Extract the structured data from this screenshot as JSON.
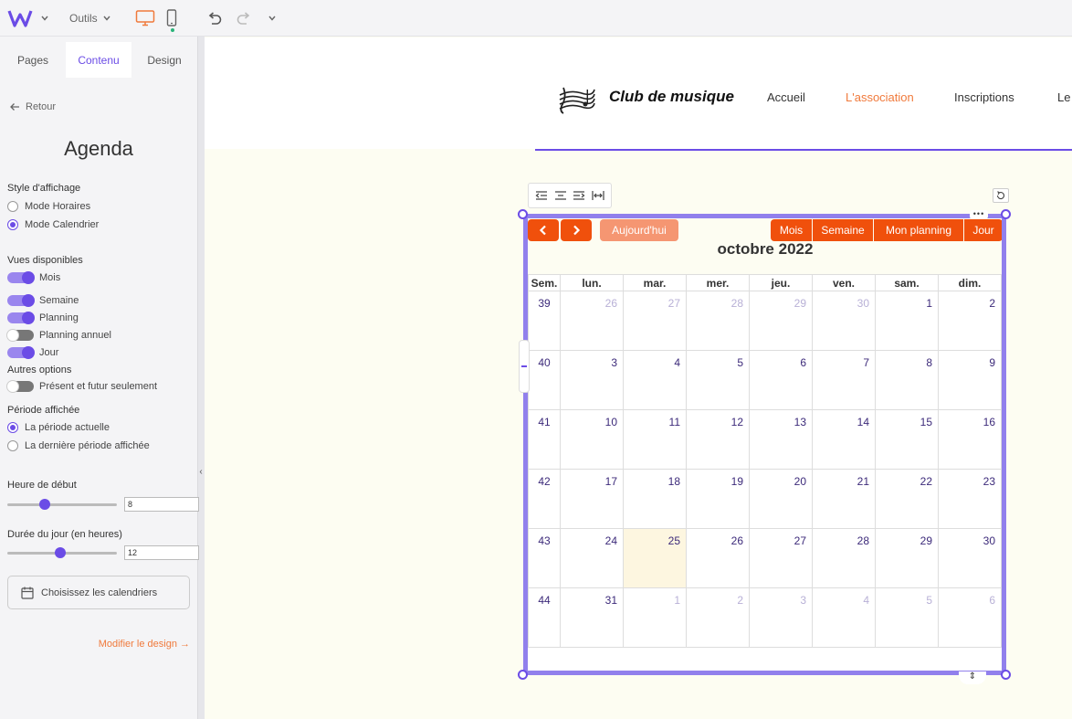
{
  "toolbar": {
    "tools_label": "Outils",
    "logo_icon": "wix-w-logo",
    "accent": "#6b4ce6"
  },
  "panel": {
    "tabs": [
      {
        "label": "Pages"
      },
      {
        "label": "Contenu"
      },
      {
        "label": "Design"
      }
    ],
    "back_label": "Retour",
    "title": "Agenda",
    "display_style": {
      "label": "Style d'affichage",
      "options": [
        {
          "label": "Mode Horaires",
          "selected": false
        },
        {
          "label": "Mode Calendrier",
          "selected": true
        }
      ]
    },
    "available_views": {
      "label": "Vues disponibles",
      "items": [
        {
          "label": "Mois",
          "on": true
        },
        {
          "label": "Semaine",
          "on": true
        },
        {
          "label": "Planning",
          "on": true
        },
        {
          "label": "Planning annuel",
          "on": false
        },
        {
          "label": "Jour",
          "on": true
        }
      ]
    },
    "other_options": {
      "label": "Autres options",
      "items": [
        {
          "label": "Présent et futur seulement",
          "on": false
        }
      ]
    },
    "period": {
      "label": "Période affichée",
      "options": [
        {
          "label": "La période actuelle",
          "selected": true
        },
        {
          "label": "La dernière période affichée",
          "selected": false
        }
      ]
    },
    "start_hour": {
      "label": "Heure de début",
      "value": "8",
      "fraction": 0.34
    },
    "day_duration": {
      "label": "Durée du jour (en heures)",
      "value": "12",
      "fraction": 0.48
    },
    "choose_calendars_label": "Choisissez les calendriers",
    "modify_design_label": "Modifier le design →"
  },
  "site": {
    "name": "Club de musique",
    "nav": [
      {
        "label": "Accueil",
        "active": false
      },
      {
        "label": "L'association",
        "active": true
      },
      {
        "label": "Inscriptions",
        "active": false
      },
      {
        "label": "Le",
        "active": false
      }
    ]
  },
  "calendar": {
    "title": "octobre 2022",
    "prev_label": "‹",
    "next_label": "›",
    "today_label": "Aujourd'hui",
    "views": [
      "Mois",
      "Semaine",
      "Mon planning",
      "Jour"
    ],
    "headers": [
      "Sem.",
      "lun.",
      "mar.",
      "mer.",
      "jeu.",
      "ven.",
      "sam.",
      "dim."
    ],
    "weeks": [
      {
        "week": "39",
        "days": [
          "26",
          "27",
          "28",
          "29",
          "30",
          "1",
          "2"
        ],
        "muted": [
          true,
          true,
          true,
          true,
          true,
          false,
          false
        ]
      },
      {
        "week": "40",
        "days": [
          "3",
          "4",
          "5",
          "6",
          "7",
          "8",
          "9"
        ],
        "muted": [
          false,
          false,
          false,
          false,
          false,
          false,
          false
        ]
      },
      {
        "week": "41",
        "days": [
          "10",
          "11",
          "12",
          "13",
          "14",
          "15",
          "16"
        ],
        "muted": [
          false,
          false,
          false,
          false,
          false,
          false,
          false
        ]
      },
      {
        "week": "42",
        "days": [
          "17",
          "18",
          "19",
          "20",
          "21",
          "22",
          "23"
        ],
        "muted": [
          false,
          false,
          false,
          false,
          false,
          false,
          false
        ]
      },
      {
        "week": "43",
        "days": [
          "24",
          "25",
          "26",
          "27",
          "28",
          "29",
          "30"
        ],
        "muted": [
          false,
          false,
          false,
          false,
          false,
          false,
          false
        ],
        "today_index": 1
      },
      {
        "week": "44",
        "days": [
          "31",
          "1",
          "2",
          "3",
          "4",
          "5",
          "6"
        ],
        "muted": [
          false,
          true,
          true,
          true,
          true,
          true,
          true
        ]
      }
    ],
    "button_color": "#f0500c",
    "today_button_color": "#f59672"
  }
}
